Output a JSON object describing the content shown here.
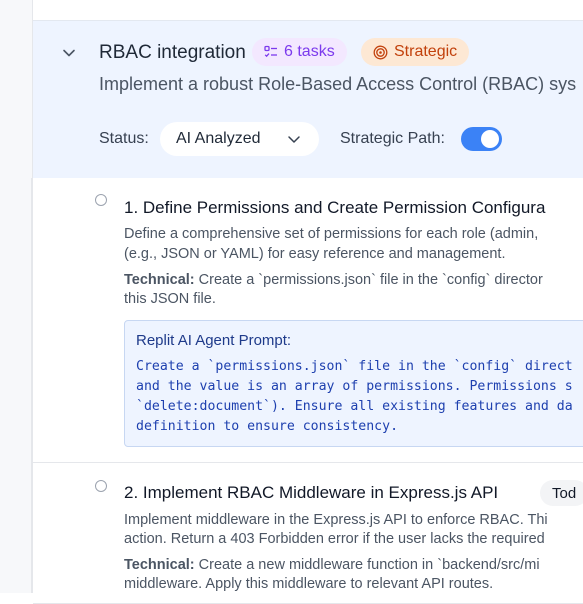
{
  "section": {
    "title": "RBAC integration",
    "tasks_badge": "6 tasks",
    "strategic_badge": "Strategic",
    "description": "Implement a robust Role-Based Access Control (RBAC) sys",
    "status_label": "Status:",
    "status_value": "AI Analyzed",
    "strategic_path_label": "Strategic Path:",
    "strategic_path_enabled": true
  },
  "tasks": [
    {
      "title": "1. Define Permissions and Create Permission Configura",
      "description_lines": [
        "Define a comprehensive set of permissions for each role (admin,",
        "(e.g., JSON or YAML) for easy reference and management."
      ],
      "technical_label": "Technical:",
      "technical_line1": " Create a `permissions.json` file in the `config` director",
      "technical_line2": "this JSON file.",
      "prompt_title": "Replit AI Agent Prompt:",
      "prompt_lines": [
        "Create a `permissions.json` file in the `config` direct",
        "and the value is an array of permissions. Permissions s",
        "`delete:document`). Ensure all existing features and da",
        "definition to ensure consistency."
      ]
    },
    {
      "title": "2. Implement RBAC Middleware in Express.js API",
      "badge": "Tod",
      "description_lines": [
        "Implement middleware in the Express.js API to enforce RBAC. Thi",
        "action. Return a 403 Forbidden error if the user lacks the required"
      ],
      "technical_label": "Technical:",
      "technical_line1": " Create a new middleware function in `backend/src/mi",
      "technical_line2": "middleware. Apply this middleware to relevant API routes."
    }
  ],
  "colors": {
    "accent": "#3b82f6",
    "header_bg": "#eef4ff",
    "tasks_badge_bg": "#f3e8ff",
    "strategic_badge_bg": "#fde8d4"
  },
  "icons": {
    "collapse": "chevron-down-icon",
    "tasks": "checklist-icon",
    "strategic": "target-icon",
    "select": "chevron-down-icon"
  }
}
